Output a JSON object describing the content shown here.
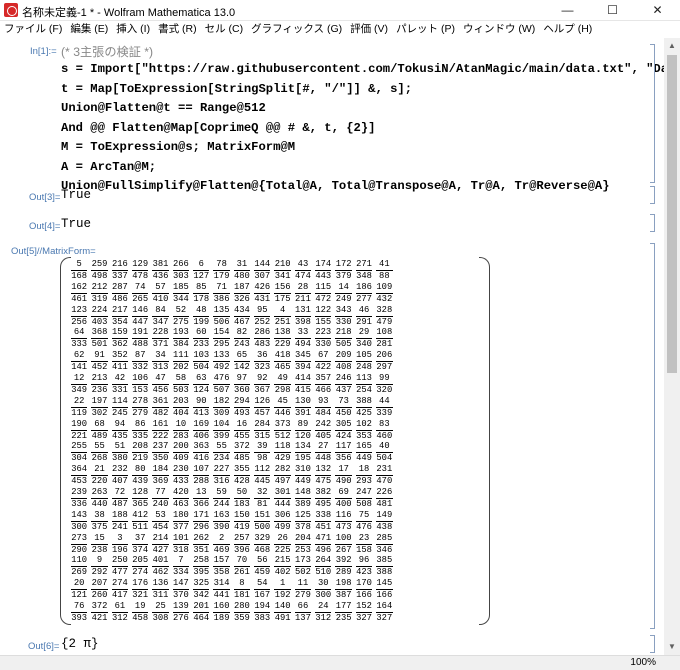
{
  "window": {
    "title": "名称未定義-1 * - Wolfram Mathematica 13.0"
  },
  "menu": [
    "ファイル (F)",
    "編集 (E)",
    "挿入 (I)",
    "書式 (R)",
    "セル (C)",
    "グラフィックス (G)",
    "評価 (V)",
    "パレット (P)",
    "ウィンドウ (W)",
    "ヘルプ (H)"
  ],
  "cells": {
    "in1": {
      "label": "In[1]:=",
      "comment": "(* 3主張の検証 *)"
    },
    "out3": {
      "label": "Out[3]=",
      "value": "True"
    },
    "out4": {
      "label": "Out[4]=",
      "value": "True"
    },
    "out5": {
      "label": "Out[5]//MatrixForm="
    },
    "out6": {
      "label": "Out[6]=",
      "value": "{2 π}"
    }
  },
  "code_lines": [
    "s = Import[\"https://raw.githubusercontent.com/TokusiN/AtanMagic/main/data.txt\", \"Data\"];",
    "t = Map[ToExpression[StringSplit[#, \"/\"]] &, s];",
    "Union@Flatten@t == Range@512",
    "And @@ Flatten@Map[CoprimeQ @@ # &, t, {2}]",
    "M = ToExpression@s; MatrixForm@M",
    "A = ArcTan@M;",
    "Union@FullSimplify@Flatten@{Total@A, Total@Transpose@A, Tr@A, Tr@Reverse@A}"
  ],
  "matrix": [
    [
      "5/168",
      "259/498",
      "216/337",
      "129/478",
      "381/436",
      "266/303",
      "6/127",
      "78/179",
      "31/480",
      "144/307",
      "210/341",
      "43/474",
      "174/443",
      "172/379",
      "271/348",
      "41/88"
    ],
    [
      "162/461",
      "212/319",
      "287/486",
      "74/265",
      "57/410",
      "185/344",
      "85/178",
      "71/386",
      "187/326",
      "426/431",
      "156/175",
      "28/211",
      "115/472",
      "14/249",
      "186/277",
      "109/432"
    ],
    [
      "123/256",
      "224/403",
      "217/354",
      "146/447",
      "84/347",
      "52/275",
      "48/199",
      "135/506",
      "434/467",
      "95/252",
      "4/251",
      "131/398",
      "122/155",
      "343/330",
      "46/291",
      "328/479"
    ],
    [
      "64/333",
      "368/501",
      "159/362",
      "191/488",
      "228/371",
      "193/384",
      "60/233",
      "154/295",
      "82/243",
      "286/483",
      "138/229",
      "33/494",
      "223/330",
      "218/505",
      "29/340",
      "108/281"
    ],
    [
      "62/141",
      "91/452",
      "352/411",
      "87/332",
      "34/313",
      "111/202",
      "103/504",
      "133/492",
      "65/142",
      "36/323",
      "418/465",
      "345/394",
      "67/422",
      "209/408",
      "105/248",
      "206/297"
    ],
    [
      "12/349",
      "213/236",
      "42/331",
      "106/153",
      "47/456",
      "58/503",
      "63/124",
      "476/507",
      "97/360",
      "92/367",
      "49/298",
      "414/415",
      "357/466",
      "246/437",
      "113/254",
      "99/320"
    ],
    [
      "22/119",
      "197/302",
      "114/245",
      "278/279",
      "361/482",
      "203/404",
      "90/413",
      "182/309",
      "294/493",
      "126/457",
      "45/446",
      "130/391",
      "93/484",
      "73/450",
      "388/425",
      "44/339"
    ],
    [
      "190/221",
      "68/489",
      "94/435",
      "86/335",
      "161/222",
      "10/283",
      "169/406",
      "104/399",
      "16/455",
      "284/315",
      "373/512",
      "89/120",
      "242/405",
      "305/424",
      "102/353",
      "83/460"
    ],
    [
      "255/304",
      "55/268",
      "51/380",
      "208/219",
      "237/350",
      "200/409",
      "363/416",
      "55/234",
      "372/485",
      "39/98",
      "118/429",
      "134/195",
      "27/448",
      "117/356",
      "165/449",
      "40/504"
    ],
    [
      "364/453",
      "21/220",
      "232/407",
      "80/439",
      "184/369",
      "230/433",
      "107/288",
      "227/316",
      "355/428",
      "112/445",
      "282/497",
      "310/449",
      "132/475",
      "17/490",
      "18/293",
      "231/470"
    ],
    [
      "239/336",
      "263/440",
      "72/487",
      "128/365",
      "77/240",
      "420/463",
      "13/366",
      "59/244",
      "50/183",
      "32/81",
      "301/444",
      "148/389",
      "382/495",
      "69/400",
      "247/508",
      "226/481"
    ],
    [
      "143/300",
      "38/375",
      "188/241",
      "412/511",
      "53/454",
      "180/377",
      "171/296",
      "163/390",
      "150/419",
      "151/500",
      "306/499",
      "125/378",
      "338/451",
      "116/473",
      "75/476",
      "149/438"
    ],
    [
      "273/290",
      "15/238",
      "3/196",
      "37/374",
      "214/427",
      "101/318",
      "262/351",
      "2/469",
      "257/396",
      "329/468",
      "26/225",
      "204/253",
      "471/496",
      "100/267",
      "23/158",
      "285/346"
    ],
    [
      "110/269",
      "9/292",
      "250/477",
      "205/274",
      "401/462",
      "7/334",
      "258/395",
      "157/358",
      "70/261",
      "56/459",
      "215/402",
      "173/502",
      "264/510",
      "392/289",
      "96/423",
      "385/388"
    ],
    [
      "20/121",
      "207/260",
      "274/417",
      "176/321",
      "136/311",
      "147/370",
      "325/342",
      "314/441",
      "8/181",
      "54/167",
      "1/192",
      "11/279",
      "30/300",
      "198/387",
      "170/166",
      "145/166"
    ],
    [
      "76/393",
      "372/421",
      "61/312",
      "19/458",
      "25/308",
      "139/276",
      "201/464",
      "160/189",
      "280/359",
      "194/383",
      "140/491",
      "66/137",
      "24/312",
      "177/235",
      "152/327",
      "164/327"
    ]
  ],
  "statusbar": {
    "zoom": "100%"
  }
}
